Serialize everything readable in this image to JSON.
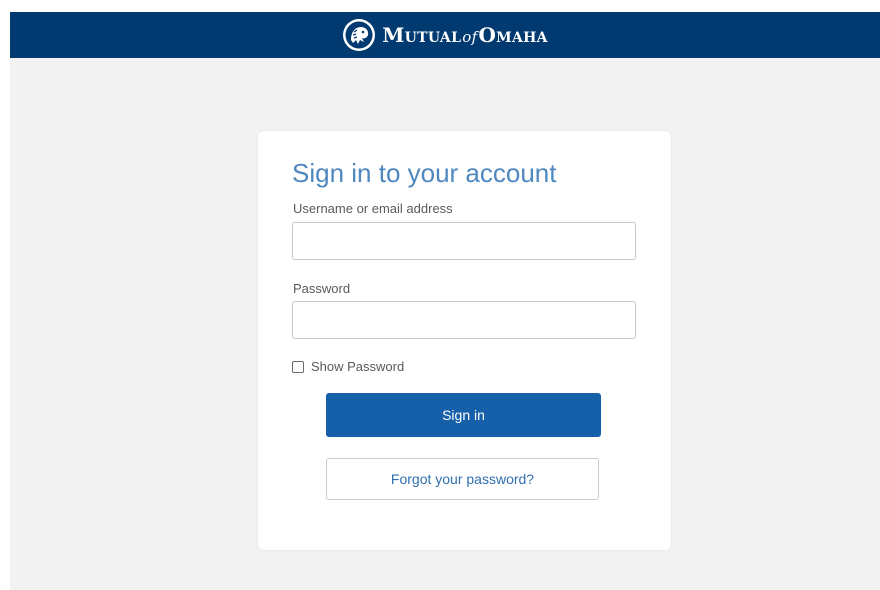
{
  "header": {
    "brand": {
      "word1": "Mutual",
      "word2": "of",
      "word3": "Omaha",
      "logo_icon": "lion-head-logo-icon"
    },
    "background_color": "#003a70"
  },
  "card": {
    "title": "Sign in to your account",
    "username": {
      "label": "Username or email address",
      "value": "",
      "placeholder": ""
    },
    "password": {
      "label": "Password",
      "value": "",
      "placeholder": ""
    },
    "show_password": {
      "label": "Show Password",
      "checked": false
    },
    "signin_label": "Sign in",
    "forgot_label": "Forgot your password?"
  },
  "colors": {
    "primary_button": "#1560a8",
    "title_text": "#4f87bf",
    "link_text": "#2f6fae"
  }
}
